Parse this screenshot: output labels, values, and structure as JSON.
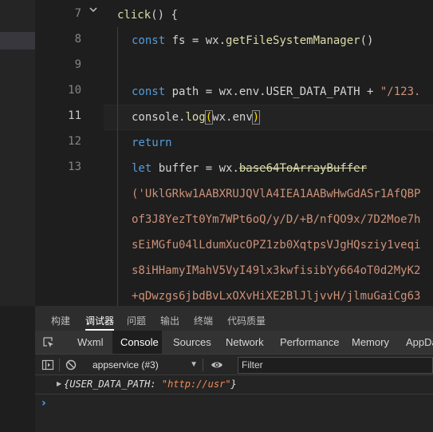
{
  "editor": {
    "lines": [
      {
        "n": "7",
        "active": false
      },
      {
        "n": "8",
        "active": false
      },
      {
        "n": "9",
        "active": false
      },
      {
        "n": "10",
        "active": false
      },
      {
        "n": "11",
        "active": true
      },
      {
        "n": "12",
        "active": false
      },
      {
        "n": "13",
        "active": false
      }
    ],
    "code": {
      "l7": {
        "name": "click",
        "paren": "()",
        "brace": " {"
      },
      "l8": {
        "kw": "const",
        "ident": " fs = wx.",
        "fn": "getFileSystemManager",
        "end": "()"
      },
      "l10": {
        "kw": "const",
        "ident": " path = wx.env.USER_DATA_PATH + ",
        "str": "\"/123."
      },
      "l11": {
        "obj": "console.",
        "fn": "log",
        "open": "(",
        "arg": "wx.env",
        "close": ")"
      },
      "l12": {
        "kw": "return"
      },
      "l13": {
        "kw": "let",
        "ident": " buffer = wx.",
        "fn": "base64ToArrayBuffer"
      },
      "s1": "('UklGRkw1AABXRUJQVlA4IEA1AABwHwGdASr1AfQBP",
      "s2": "of3J8YezTt0Ym7WPt6oQ/y/D/+B/nfQO9x/7D2Moe7h",
      "s3": "sEiMGfu04lLdumXucOPZ1zb0XqtpsVJgHQsziy1veqi",
      "s4": "s8iHHamyIMahV5VyI49lx3kwfisibYy664oT0d2MyK2",
      "s5": "+qDwzgs6jbdBvLxOXvHiXE2BlJljvvH/jlmuGaiCg63"
    }
  },
  "devtools": {
    "top_tabs": [
      "构建",
      "调试器",
      "问题",
      "输出",
      "终端",
      "代码质量"
    ],
    "top_active": "调试器",
    "tool_tabs": [
      "Wxml",
      "Console",
      "Sources",
      "Network",
      "Performance",
      "Memory",
      "AppData"
    ],
    "tool_active": "Console",
    "context": "appservice (#3)",
    "filter_placeholder": "Filter",
    "log": {
      "open": "{",
      "key": "USER_DATA_PATH",
      "sep": ": ",
      "value": "\"http://usr\"",
      "close": "}"
    },
    "prompt": "›"
  },
  "colors": {
    "keyword": "#569cd6",
    "function": "#dcdcaa",
    "string": "#ce9178",
    "console_string": "#f28b54",
    "prompt": "#4ea3ff"
  }
}
